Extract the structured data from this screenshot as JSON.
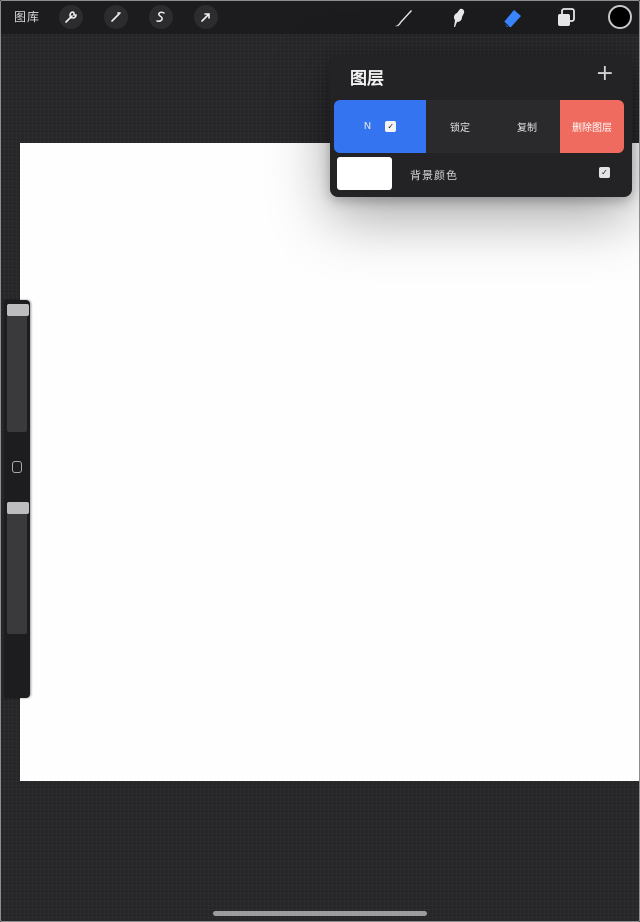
{
  "topbar": {
    "gallery_label": "图库",
    "left_tools": [
      {
        "icon": "wrench-icon",
        "glyph": "🔧"
      },
      {
        "icon": "magic-wand-icon",
        "glyph": "⁄"
      },
      {
        "icon": "selection-icon",
        "glyph": "S"
      },
      {
        "icon": "transform-arrow-icon",
        "glyph": "➶"
      }
    ],
    "right_tools": [
      {
        "icon": "brush-icon"
      },
      {
        "icon": "smudge-icon"
      },
      {
        "icon": "eraser-icon"
      },
      {
        "icon": "layers-icon"
      }
    ],
    "current_color": "#000000"
  },
  "layers_panel": {
    "title": "图层",
    "add_symbol": "+",
    "actions": {
      "name_label": "N",
      "lock_label": "锁定",
      "duplicate_label": "复制",
      "delete_label": "删除图层"
    },
    "background_layer": {
      "label": "背景颜色",
      "color": "#ffffff",
      "visible": true
    }
  },
  "colors": {
    "accent_blue": "#3574f0",
    "delete_red": "#ef6a5f"
  }
}
